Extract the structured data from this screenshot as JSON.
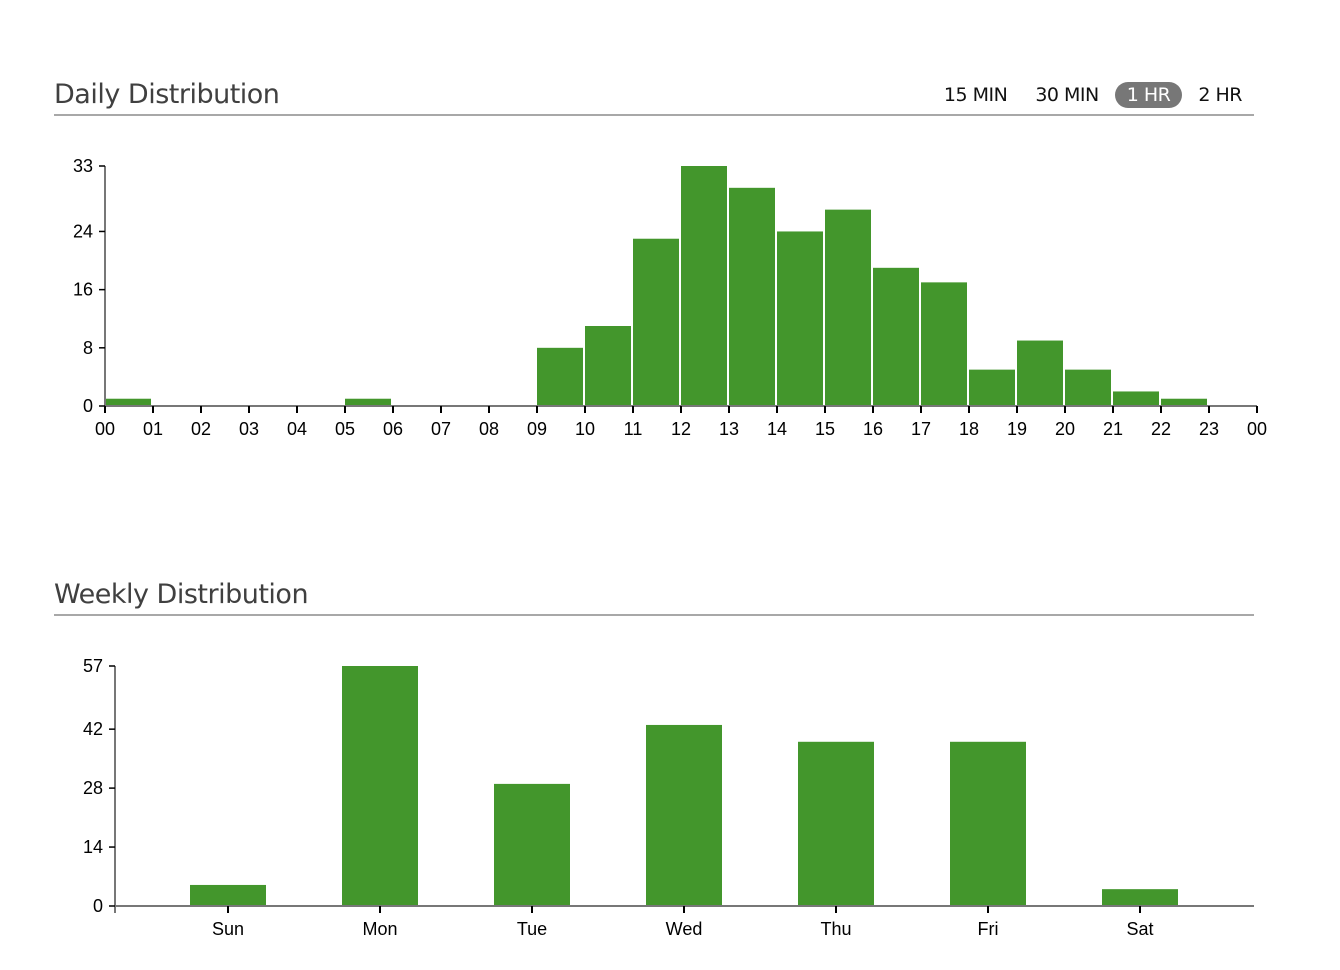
{
  "daily": {
    "title": "Daily Distribution",
    "ranges": [
      {
        "label": "15 MIN",
        "active": false
      },
      {
        "label": "30 MIN",
        "active": false
      },
      {
        "label": "1 HR",
        "active": true
      },
      {
        "label": "2 HR",
        "active": false
      }
    ]
  },
  "weekly": {
    "title": "Weekly Distribution"
  },
  "colors": {
    "bar": "#43962c",
    "axis": "#777777",
    "active_toggle": "#777777"
  },
  "chart_data": [
    {
      "type": "bar",
      "title": "Daily Distribution",
      "xlabel": "",
      "ylabel": "",
      "categories": [
        "00",
        "01",
        "02",
        "03",
        "04",
        "05",
        "06",
        "07",
        "08",
        "09",
        "10",
        "11",
        "12",
        "13",
        "14",
        "15",
        "16",
        "17",
        "18",
        "19",
        "20",
        "21",
        "22",
        "23"
      ],
      "x_tick_labels": [
        "00",
        "01",
        "02",
        "03",
        "04",
        "05",
        "06",
        "07",
        "08",
        "09",
        "10",
        "11",
        "12",
        "13",
        "14",
        "15",
        "16",
        "17",
        "18",
        "19",
        "20",
        "21",
        "22",
        "23",
        "00"
      ],
      "values": [
        1,
        0,
        0,
        0,
        0,
        1,
        0,
        0,
        0,
        8,
        11,
        23,
        33,
        30,
        24,
        27,
        19,
        17,
        5,
        9,
        5,
        2,
        1,
        0
      ],
      "y_ticks": [
        0,
        8,
        16,
        24,
        33
      ],
      "ylim": [
        0,
        33
      ],
      "grid": false,
      "bin": "1 HR"
    },
    {
      "type": "bar",
      "title": "Weekly Distribution",
      "xlabel": "",
      "ylabel": "",
      "categories": [
        "Sun",
        "Mon",
        "Tue",
        "Wed",
        "Thu",
        "Fri",
        "Sat"
      ],
      "values": [
        5,
        57,
        29,
        43,
        39,
        39,
        4
      ],
      "y_ticks": [
        0,
        14,
        28,
        42,
        57
      ],
      "ylim": [
        0,
        57
      ],
      "grid": false
    }
  ]
}
